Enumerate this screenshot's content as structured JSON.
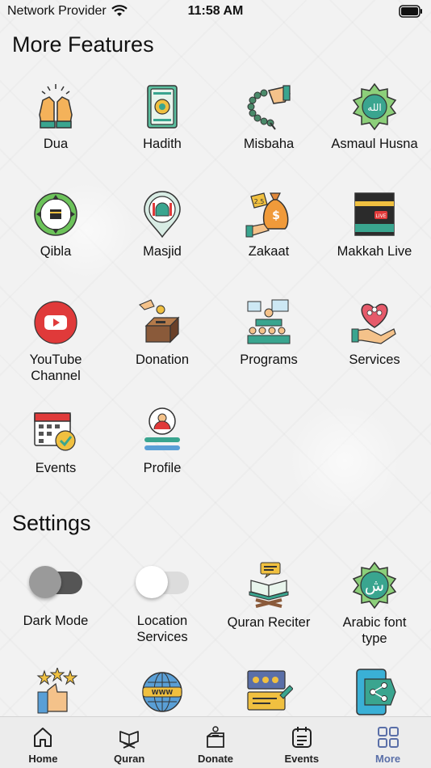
{
  "status_bar": {
    "carrier": "Network Provider",
    "time": "11:58 AM"
  },
  "features": {
    "title": "More Features",
    "items": [
      {
        "label": "Dua",
        "icon": "praying-hands-icon"
      },
      {
        "label": "Hadith",
        "icon": "book-icon"
      },
      {
        "label": "Misbaha",
        "icon": "prayer-beads-icon"
      },
      {
        "label": "Asmaul Husna",
        "icon": "allah-calligraphy-icon"
      },
      {
        "label": "Qibla",
        "icon": "compass-icon"
      },
      {
        "label": "Masjid",
        "icon": "mosque-pin-icon"
      },
      {
        "label": "Zakaat",
        "icon": "money-bag-icon"
      },
      {
        "label": "Makkah Live",
        "icon": "kaaba-icon"
      },
      {
        "label": "YouTube\nChannel",
        "icon": "youtube-icon"
      },
      {
        "label": "Donation",
        "icon": "donation-box-icon"
      },
      {
        "label": "Programs",
        "icon": "audience-icon"
      },
      {
        "label": "Services",
        "icon": "heart-hand-icon"
      },
      {
        "label": "Events",
        "icon": "calendar-check-icon"
      },
      {
        "label": "Profile",
        "icon": "profile-icon"
      }
    ]
  },
  "settings": {
    "title": "Settings",
    "dark_mode": {
      "label": "Dark Mode",
      "on": false
    },
    "location": {
      "label": "Location\nServices",
      "on": false
    },
    "quran_reciter": {
      "label": "Quran Reciter",
      "icon": "quran-stand-icon"
    },
    "arabic_font": {
      "label": "Arabic font\ntype",
      "icon": "arabic-letter-icon"
    },
    "row2_icons": [
      "rate-app-icon",
      "website-icon",
      "feedback-icon",
      "share-app-icon"
    ]
  },
  "tabbar": {
    "items": [
      {
        "label": "Home",
        "icon": "home-icon",
        "active": false
      },
      {
        "label": "Quran",
        "icon": "quran-icon",
        "active": false
      },
      {
        "label": "Donate",
        "icon": "donate-icon",
        "active": false
      },
      {
        "label": "Events",
        "icon": "events-icon",
        "active": false
      },
      {
        "label": "More",
        "icon": "more-grid-icon",
        "active": true
      }
    ]
  },
  "colors": {
    "accent": "#5a6fa8",
    "teal": "#3aa58f",
    "orange": "#f0a040",
    "red": "#e03a3a",
    "toggle_track": "#555555"
  }
}
